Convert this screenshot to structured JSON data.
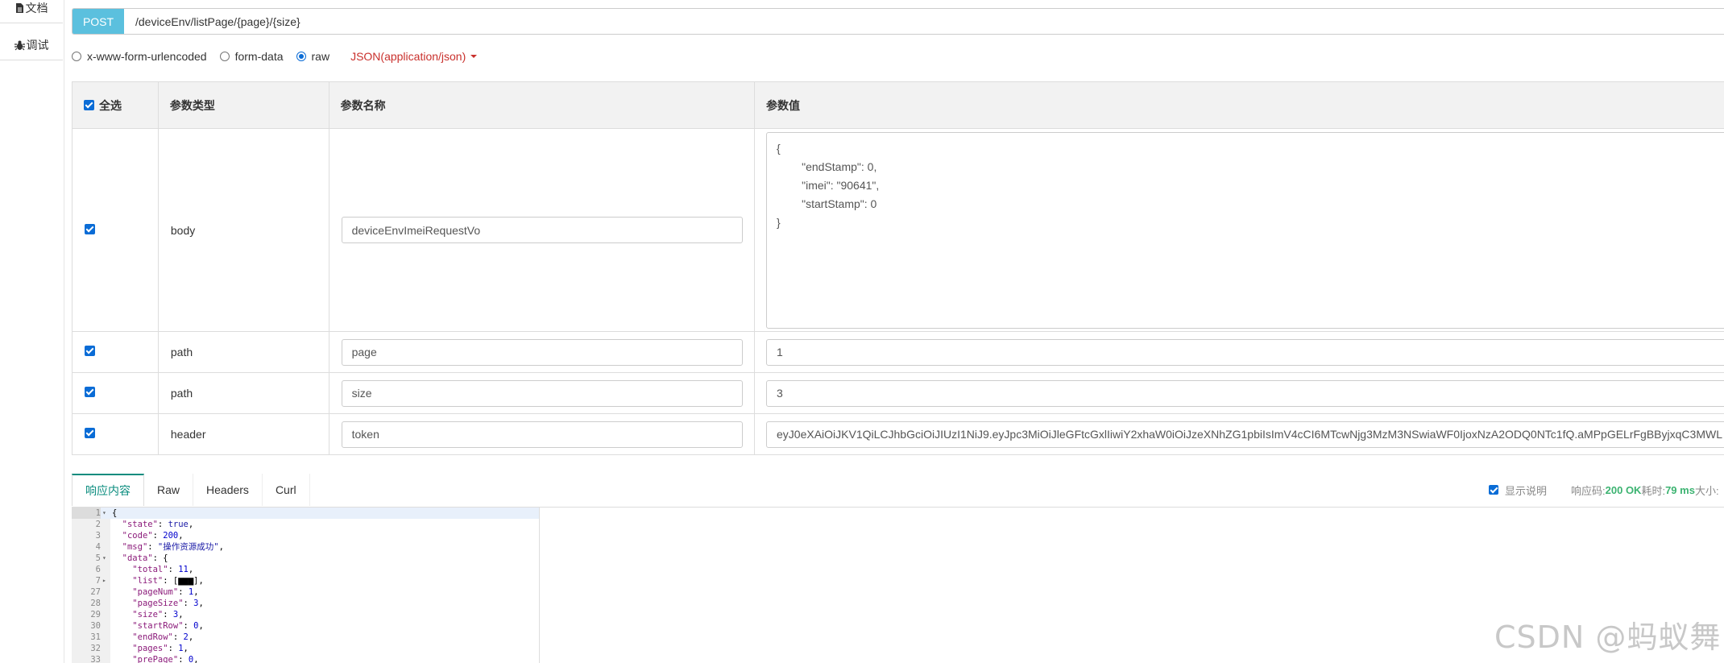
{
  "sidebar": {
    "items": [
      {
        "label": "文档",
        "icon": "file-icon"
      },
      {
        "label": "调试",
        "icon": "bug-icon"
      }
    ]
  },
  "request": {
    "method": "POST",
    "url": "/deviceEnv/listPage/{page}/{size}"
  },
  "body_types": {
    "options": [
      "x-www-form-urlencoded",
      "form-data",
      "raw"
    ],
    "selected": "raw",
    "content_type": "JSON(application/json)"
  },
  "params_table": {
    "headers": {
      "select_all": "全选",
      "type": "参数类型",
      "name": "参数名称",
      "value": "参数值"
    },
    "rows": [
      {
        "checked": true,
        "type": "body",
        "name": "deviceEnvImeiRequestVo",
        "value": "{\n        \"endStamp\": 0,\n        \"imei\": \"90641\",\n        \"startStamp\": 0\n}"
      },
      {
        "checked": true,
        "type": "path",
        "name": "page",
        "value": "1"
      },
      {
        "checked": true,
        "type": "path",
        "name": "size",
        "value": "3"
      },
      {
        "checked": true,
        "type": "header",
        "name": "token",
        "value": "eyJ0eXAiOiJKV1QiLCJhbGciOiJIUzI1NiJ9.eyJpc3MiOiJleGFtcGxlIiwiY2xhaW0iOiJzeXNhZG1pbiIsImV4cCI6MTcwNjg3MzM3NSwiaWF0IjoxNzA2ODQ0NTc1fQ.aMPpGELrFgBByjxqC3MWL"
      }
    ]
  },
  "response": {
    "tabs": [
      "响应内容",
      "Raw",
      "Headers",
      "Curl"
    ],
    "active_tab": "响应内容",
    "show_desc_label": "显示说明",
    "code_label": "响应码:",
    "code_value": "200 OK",
    "time_label": "耗时:",
    "time_value": "79 ms",
    "size_label": "大小:"
  },
  "code_lines": [
    {
      "num": "1",
      "fold": "▾",
      "text": "{"
    },
    {
      "num": "2",
      "fold": "",
      "text": "  \"state\": true,"
    },
    {
      "num": "3",
      "fold": "",
      "text": "  \"code\": 200,"
    },
    {
      "num": "4",
      "fold": "",
      "text": "  \"msg\": \"操作资源成功\","
    },
    {
      "num": "5",
      "fold": "▾",
      "text": "  \"data\": {"
    },
    {
      "num": "6",
      "fold": "",
      "text": "    \"total\": 11,"
    },
    {
      "num": "7",
      "fold": "▸",
      "text": "    \"list\": [▆▆▆],"
    },
    {
      "num": "27",
      "fold": "",
      "text": "    \"pageNum\": 1,"
    },
    {
      "num": "28",
      "fold": "",
      "text": "    \"pageSize\": 3,"
    },
    {
      "num": "29",
      "fold": "",
      "text": "    \"size\": 3,"
    },
    {
      "num": "30",
      "fold": "",
      "text": "    \"startRow\": 0,"
    },
    {
      "num": "31",
      "fold": "",
      "text": "    \"endRow\": 2,"
    },
    {
      "num": "32",
      "fold": "",
      "text": "    \"pages\": 1,"
    },
    {
      "num": "33",
      "fold": "",
      "text": "    \"prePage\": 0,"
    }
  ],
  "watermark": "CSDN @蚂蚁舞"
}
